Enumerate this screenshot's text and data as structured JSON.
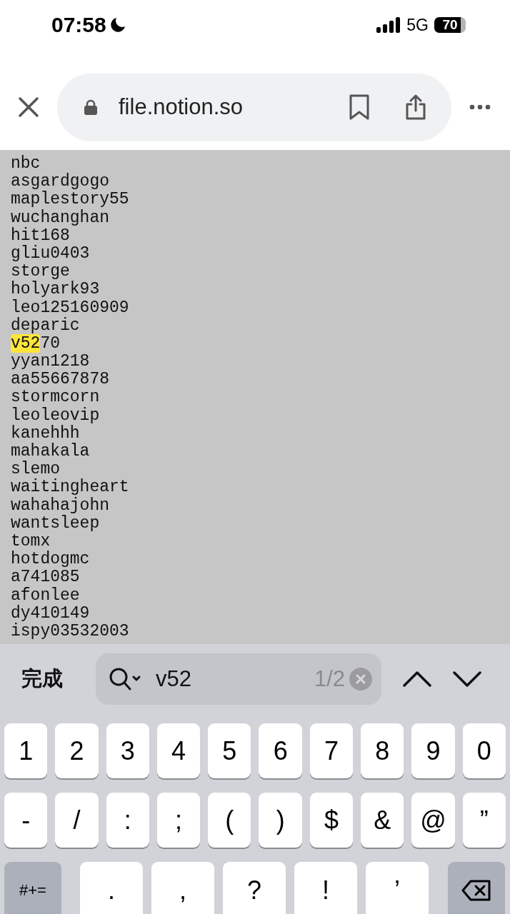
{
  "status_bar": {
    "time": "07:58",
    "network": "5G",
    "battery": "70"
  },
  "address_bar": {
    "url": "file.notion.so"
  },
  "page": {
    "lines": [
      {
        "segments": [
          {
            "text": "nbc",
            "highlighted": false
          }
        ]
      },
      {
        "segments": [
          {
            "text": "asgardgogo",
            "highlighted": false
          }
        ]
      },
      {
        "segments": [
          {
            "text": "maplestory55",
            "highlighted": false
          }
        ]
      },
      {
        "segments": [
          {
            "text": "wuchanghan",
            "highlighted": false
          }
        ]
      },
      {
        "segments": [
          {
            "text": "hit168",
            "highlighted": false
          }
        ]
      },
      {
        "segments": [
          {
            "text": "gliu0403",
            "highlighted": false
          }
        ]
      },
      {
        "segments": [
          {
            "text": "storge",
            "highlighted": false
          }
        ]
      },
      {
        "segments": [
          {
            "text": "holyark93",
            "highlighted": false
          }
        ]
      },
      {
        "segments": [
          {
            "text": "leo125160909",
            "highlighted": false
          }
        ]
      },
      {
        "segments": [
          {
            "text": "deparic",
            "highlighted": false
          }
        ]
      },
      {
        "segments": [
          {
            "text": "v52",
            "highlighted": true
          },
          {
            "text": "70",
            "highlighted": false
          }
        ]
      },
      {
        "segments": [
          {
            "text": "yyan1218",
            "highlighted": false
          }
        ]
      },
      {
        "segments": [
          {
            "text": "aa55667878",
            "highlighted": false
          }
        ]
      },
      {
        "segments": [
          {
            "text": "stormcorn",
            "highlighted": false
          }
        ]
      },
      {
        "segments": [
          {
            "text": "leoleovip",
            "highlighted": false
          }
        ]
      },
      {
        "segments": [
          {
            "text": "kanehhh",
            "highlighted": false
          }
        ]
      },
      {
        "segments": [
          {
            "text": "mahakala",
            "highlighted": false
          }
        ]
      },
      {
        "segments": [
          {
            "text": "slemo",
            "highlighted": false
          }
        ]
      },
      {
        "segments": [
          {
            "text": "waitingheart",
            "highlighted": false
          }
        ]
      },
      {
        "segments": [
          {
            "text": "wahahajohn",
            "highlighted": false
          }
        ]
      },
      {
        "segments": [
          {
            "text": "wantsleep",
            "highlighted": false
          }
        ]
      },
      {
        "segments": [
          {
            "text": "tomx",
            "highlighted": false
          }
        ]
      },
      {
        "segments": [
          {
            "text": "hotdogmc",
            "highlighted": false
          }
        ]
      },
      {
        "segments": [
          {
            "text": "a741085",
            "highlighted": false
          }
        ]
      },
      {
        "segments": [
          {
            "text": "afonlee",
            "highlighted": false
          }
        ]
      },
      {
        "segments": [
          {
            "text": "dy410149",
            "highlighted": false
          }
        ]
      },
      {
        "segments": [
          {
            "text": "ispy03532003",
            "highlighted": false
          }
        ]
      }
    ]
  },
  "find_bar": {
    "done": "完成",
    "query": "v52",
    "count": "1/2"
  },
  "keyboard": {
    "rows": [
      {
        "keys": [
          {
            "kind": "char",
            "label": "1"
          },
          {
            "kind": "char",
            "label": "2"
          },
          {
            "kind": "char",
            "label": "3"
          },
          {
            "kind": "char",
            "label": "4"
          },
          {
            "kind": "char",
            "label": "5"
          },
          {
            "kind": "char",
            "label": "6"
          },
          {
            "kind": "char",
            "label": "7"
          },
          {
            "kind": "char",
            "label": "8"
          },
          {
            "kind": "char",
            "label": "9"
          },
          {
            "kind": "char",
            "label": "0"
          }
        ]
      },
      {
        "keys": [
          {
            "kind": "char",
            "label": "-"
          },
          {
            "kind": "char",
            "label": "/"
          },
          {
            "kind": "char",
            "label": ":"
          },
          {
            "kind": "char",
            "label": ";"
          },
          {
            "kind": "char",
            "label": "("
          },
          {
            "kind": "char",
            "label": ")"
          },
          {
            "kind": "char",
            "label": "$"
          },
          {
            "kind": "char",
            "label": "&"
          },
          {
            "kind": "char",
            "label": "@"
          },
          {
            "kind": "char",
            "label": "”"
          }
        ]
      },
      {
        "keys": [
          {
            "kind": "mode",
            "label": "#+="
          },
          {
            "kind": "char",
            "label": "."
          },
          {
            "kind": "char",
            "label": ","
          },
          {
            "kind": "char",
            "label": "?"
          },
          {
            "kind": "char",
            "label": "!"
          },
          {
            "kind": "char",
            "label": "’"
          },
          {
            "kind": "delete"
          }
        ]
      }
    ]
  }
}
